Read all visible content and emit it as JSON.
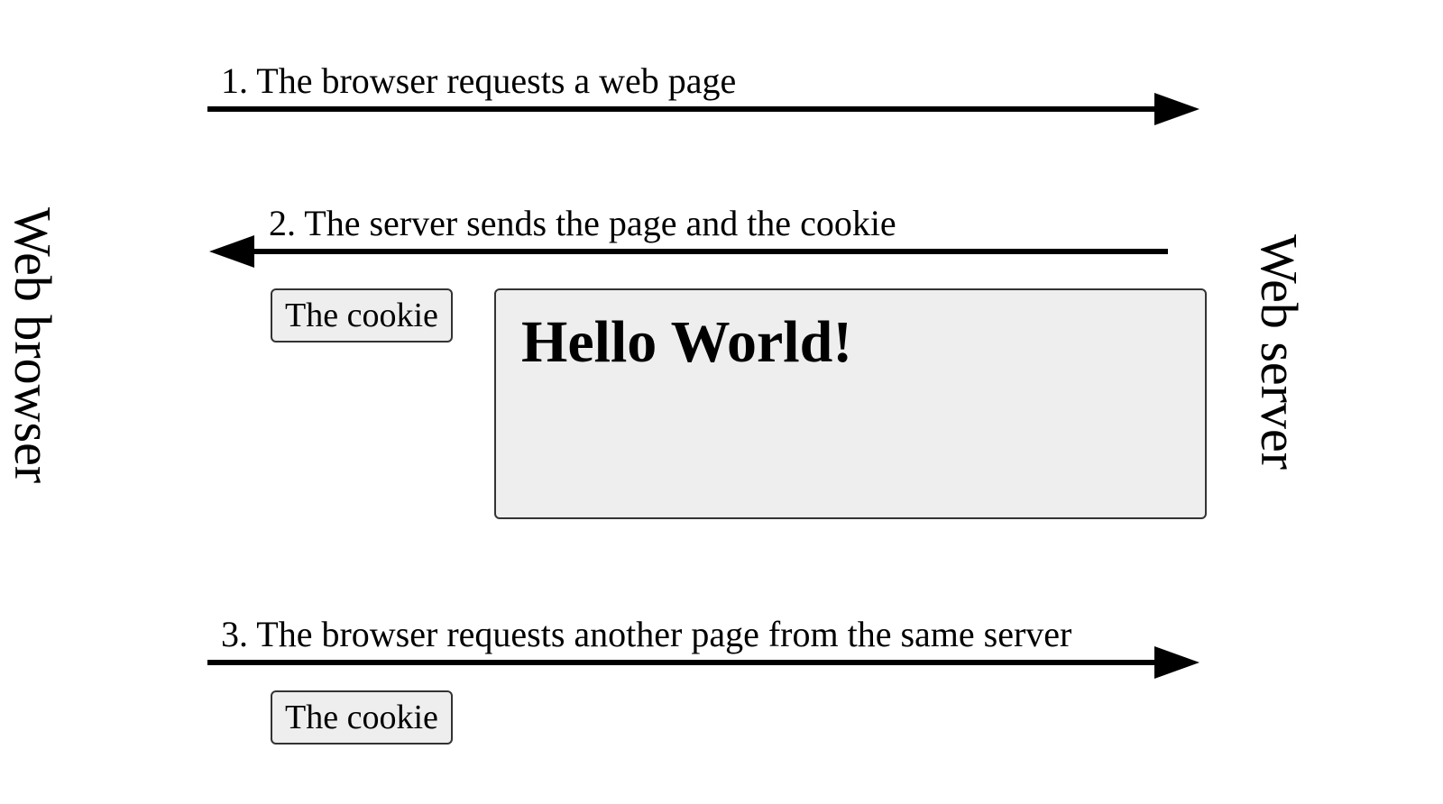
{
  "actors": {
    "left": "Web browser",
    "right": "Web server"
  },
  "steps": {
    "s1": "1. The browser requests a web page",
    "s2": "2. The server sends the page and the cookie",
    "s3": "3. The browser requests another page from the same server"
  },
  "boxes": {
    "cookie": "The cookie",
    "page_content": "Hello World!"
  }
}
